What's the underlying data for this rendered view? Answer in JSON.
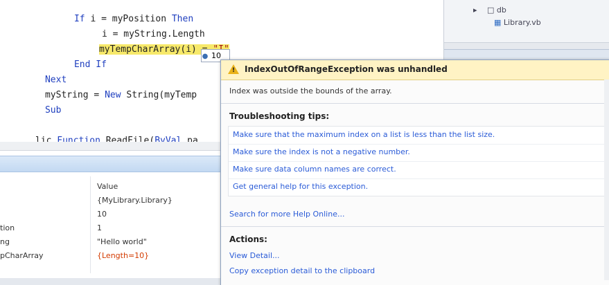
{
  "editor": {
    "lines": [
      {
        "parts": [
          {
            "t": "If",
            "k": "kw"
          },
          {
            "t": " i = myPosition ",
            "k": "tx"
          },
          {
            "t": "Then",
            "k": "kw"
          }
        ]
      },
      {
        "parts": [
          {
            "t": "i = myString.Length",
            "k": "tx"
          }
        ]
      },
      {
        "parts": [
          {
            "t": "myTempCharArray(i) = ",
            "k": "hl"
          },
          {
            "t": "\"I\"",
            "k": "hlstr"
          }
        ]
      },
      {
        "parts": [
          {
            "t": "End If",
            "k": "kw"
          }
        ]
      },
      {
        "parts": [
          {
            "t": "Next",
            "k": "kw"
          }
        ]
      },
      {
        "parts": [
          {
            "t": "myString = ",
            "k": "tx"
          },
          {
            "t": "New",
            "k": "kw"
          },
          {
            "t": " String(myTemp",
            "k": "tx"
          }
        ]
      },
      {
        "parts": [
          {
            "t": "Sub",
            "k": "kw"
          }
        ]
      },
      {
        "parts": []
      },
      {
        "parts": [
          {
            "t": "lic ",
            "k": "tx"
          },
          {
            "t": "Function",
            "k": "kw"
          },
          {
            "t": " ReadFile(",
            "k": "tx"
          },
          {
            "t": "ByVal",
            "k": "kw"
          },
          {
            "t": " pa",
            "k": "tx"
          }
        ]
      }
    ],
    "datatip_value": "10"
  },
  "solution_explorer": {
    "items": [
      "db",
      "Library.vb"
    ]
  },
  "locals": {
    "header": {
      "name": "",
      "value": "Value"
    },
    "rows": [
      {
        "name": "",
        "value": "{MyLibrary.Library}",
        "red": false
      },
      {
        "name": "",
        "value": "10",
        "red": false
      },
      {
        "name": "tion",
        "value": "1",
        "red": false
      },
      {
        "name": "ng",
        "value": "\"Hello world\"",
        "red": false
      },
      {
        "name": "pCharArray",
        "value": "{Length=10}",
        "red": true
      }
    ]
  },
  "exception": {
    "title": "IndexOutOfRangeException was unhandled",
    "message": "Index was outside the bounds of the array.",
    "troubleshooting_title": "Troubleshooting tips:",
    "tips": [
      "Make sure that the maximum index on a list is less than the list size.",
      "Make sure the index is not a negative number.",
      "Make sure data column names are correct.",
      "Get general help for this exception."
    ],
    "search_link": "Search for more Help Online...",
    "actions_title": "Actions:",
    "actions": [
      "View Detail...",
      "Copy exception detail to the clipboard"
    ]
  },
  "colors": {
    "highlight": "#f7e96a",
    "exception_header": "#fff3c4",
    "link": "#2a5bd7",
    "keyword": "#1f3fbf"
  }
}
